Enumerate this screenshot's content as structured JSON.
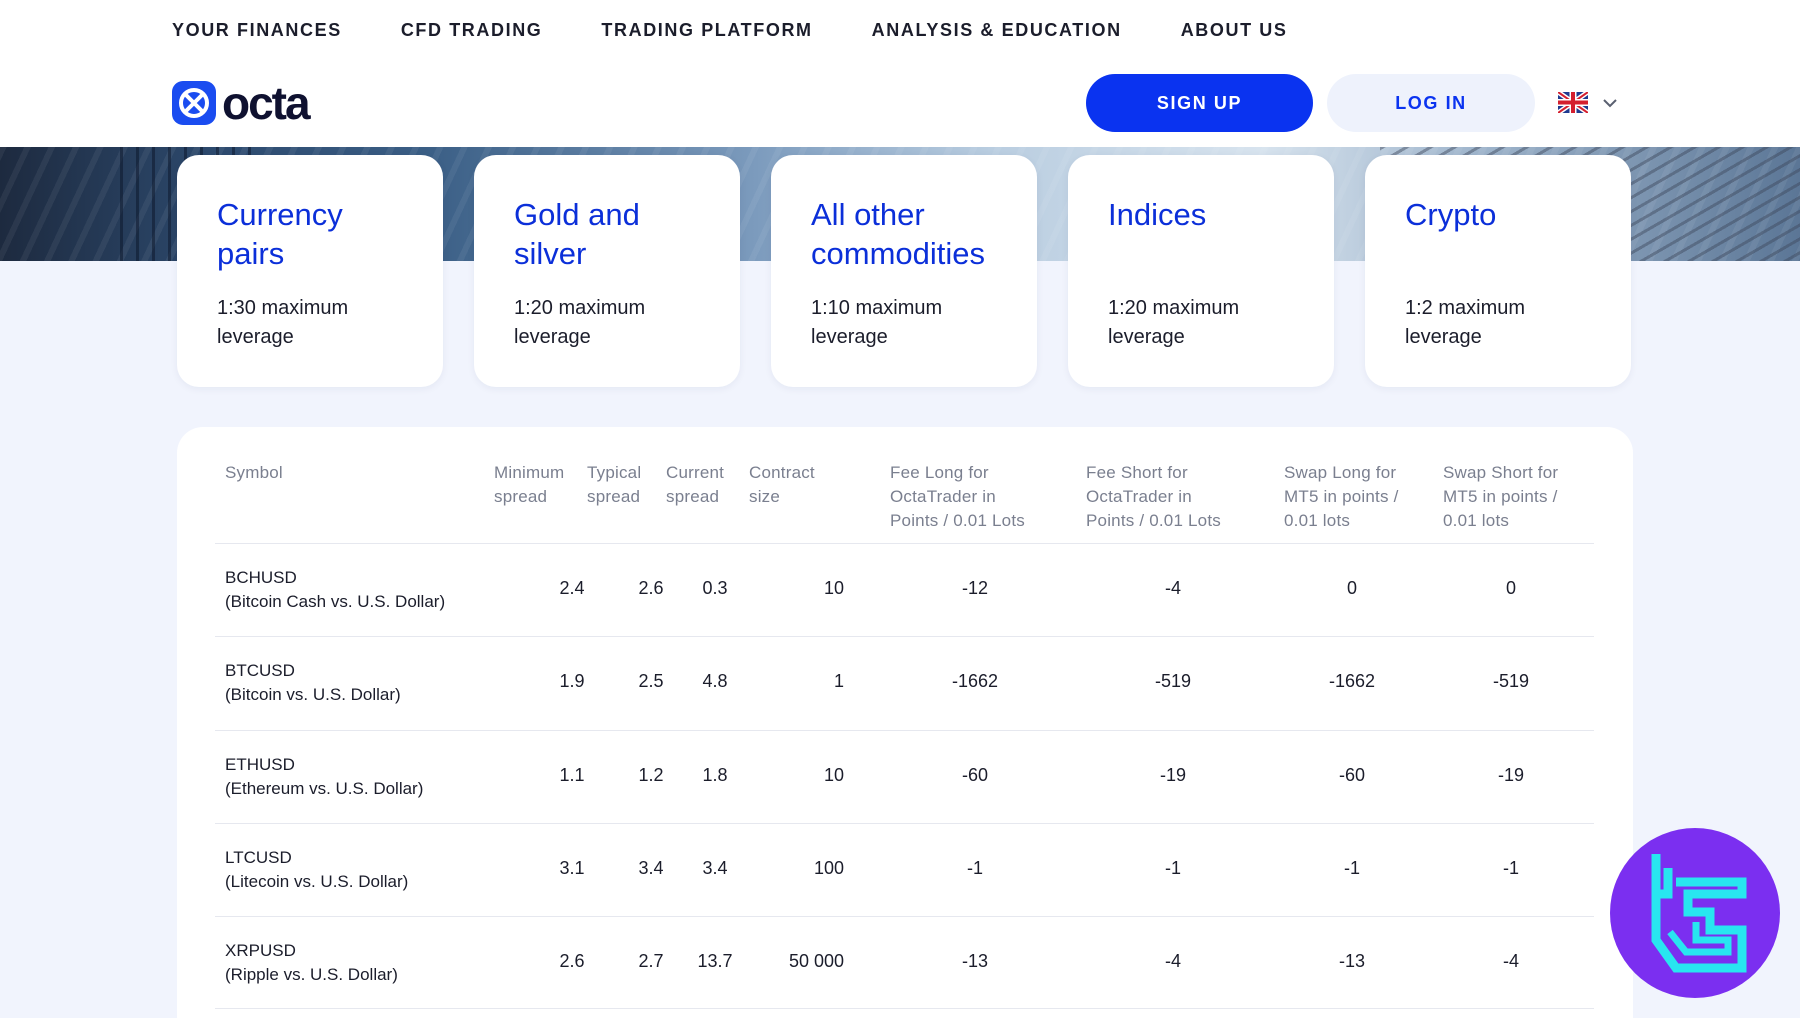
{
  "nav": {
    "items": [
      "YOUR FINANCES",
      "CFD TRADING",
      "TRADING PLATFORM",
      "ANALYSIS & EDUCATION",
      "ABOUT US"
    ],
    "logo_text": "octa",
    "signup": "SIGN UP",
    "login": "LOG IN",
    "language_icon": "uk-flag-icon"
  },
  "cards": [
    {
      "title": "Currency pairs",
      "desc": "1:30 maximum leverage"
    },
    {
      "title": "Gold and silver",
      "desc": "1:20 maximum leverage"
    },
    {
      "title": "All other commodities",
      "desc": "1:10 maximum leverage"
    },
    {
      "title": "Indices",
      "desc": "1:20 maximum leverage"
    },
    {
      "title": "Crypto",
      "desc": "1:2 maximum leverage"
    }
  ],
  "table": {
    "headers": [
      "Symbol",
      "Minimum spread",
      "Typical spread",
      "Current spread",
      "Contract size",
      "Fee Long for OctaTrader in Points / 0.01 Lots",
      "Fee Short for OctaTrader in Points / 0.01 Lots",
      "Swap Long for MT5 in points / 0.01 lots",
      "Swap Short for MT5 in points / 0.01 lots"
    ],
    "rows": [
      {
        "symbol": "BCHUSD",
        "name": "(Bitcoin Cash vs. U.S. Dollar)",
        "min": "2.4",
        "typ": "2.6",
        "cur": "0.3",
        "size": "10",
        "fee_long": "-12",
        "fee_short": "-4",
        "swap_long": "0",
        "swap_short": "0"
      },
      {
        "symbol": "BTCUSD",
        "name": "(Bitcoin vs. U.S. Dollar)",
        "min": "1.9",
        "typ": "2.5",
        "cur": "4.8",
        "size": "1",
        "fee_long": "-1662",
        "fee_short": "-519",
        "swap_long": "-1662",
        "swap_short": "-519"
      },
      {
        "symbol": "ETHUSD",
        "name": "(Ethereum vs. U.S. Dollar)",
        "min": "1.1",
        "typ": "1.2",
        "cur": "1.8",
        "size": "10",
        "fee_long": "-60",
        "fee_short": "-19",
        "swap_long": "-60",
        "swap_short": "-19"
      },
      {
        "symbol": "LTCUSD",
        "name": "(Litecoin vs. U.S. Dollar)",
        "min": "3.1",
        "typ": "3.4",
        "cur": "3.4",
        "size": "100",
        "fee_long": "-1",
        "fee_short": "-1",
        "swap_long": "-1",
        "swap_short": "-1"
      },
      {
        "symbol": "XRPUSD",
        "name": "(Ripple vs. U.S. Dollar)",
        "min": "2.6",
        "typ": "2.7",
        "cur": "13.7",
        "size": "50 000",
        "fee_long": "-13",
        "fee_short": "-4",
        "swap_long": "-13",
        "swap_short": "-4"
      }
    ]
  },
  "colors": {
    "accent": "#0a33f0",
    "card_title": "#0b2fd9",
    "watermark": "#7b2ff0",
    "watermark_glyph": "#28e6f0"
  },
  "watermark_icon": "tradingfinder-logo-icon"
}
